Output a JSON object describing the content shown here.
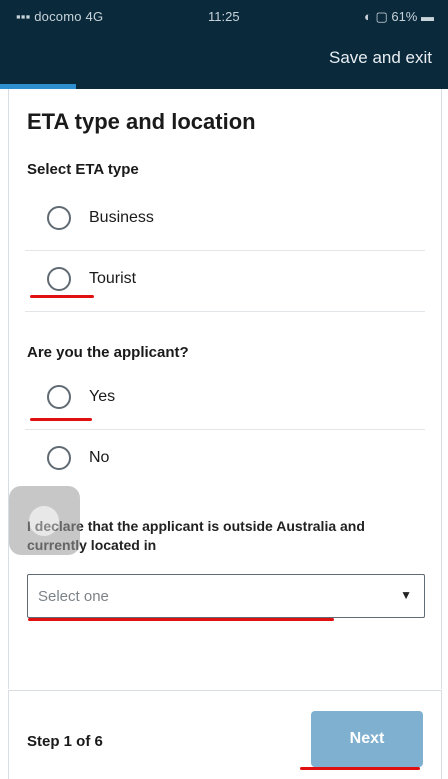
{
  "status_bar": {
    "carrier": "docomo 4G",
    "time": "11:25",
    "battery": "61%"
  },
  "header": {
    "save_exit_label": "Save and exit"
  },
  "progress": {
    "current_step": 1,
    "total_steps": 6,
    "fraction": 0.17
  },
  "page": {
    "title": "ETA type and location"
  },
  "eta_type": {
    "label": "Select ETA type",
    "options": [
      "Business",
      "Tourist"
    ]
  },
  "applicant": {
    "label": "Are you the applicant?",
    "options": [
      "Yes",
      "No"
    ]
  },
  "location": {
    "declaration": "I declare that the applicant is outside Australia and currently located in",
    "select_placeholder": "Select one"
  },
  "footer": {
    "step_text": "Step 1 of 6",
    "next_label": "Next"
  },
  "colors": {
    "header_bg": "#0a2a3c",
    "progress": "#2e8fd0",
    "next_button": "#7fb0d0",
    "annotation": "#e01010"
  }
}
